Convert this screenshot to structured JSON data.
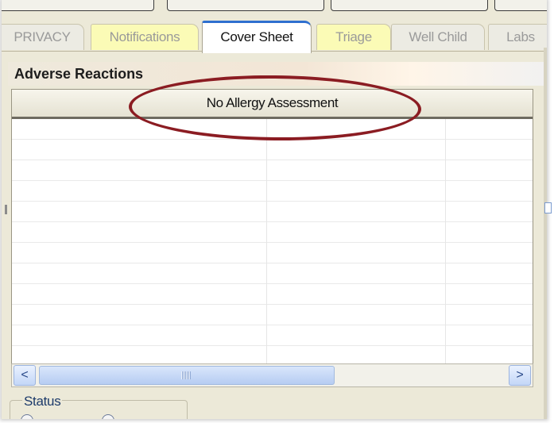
{
  "tabs": [
    {
      "label": "PRIVACY",
      "style": "grey"
    },
    {
      "label": "Notifications",
      "style": "yellow"
    },
    {
      "label": "Cover Sheet",
      "style": "active"
    },
    {
      "label": "Triage",
      "style": "yellow"
    },
    {
      "label": "Well Child",
      "style": "grey"
    },
    {
      "label": "Labs",
      "style": "grey"
    }
  ],
  "panel": {
    "title": "Adverse Reactions",
    "column_header": "No Allergy Assessment",
    "annotation_color": "#8b1c22"
  },
  "scrollbar": {
    "left_arrow": "<",
    "right_arrow": ">"
  },
  "status": {
    "label": "Status"
  },
  "colors": {
    "active_tab_accent": "#2e6fcf",
    "yellow_tab": "#fbfbb6",
    "window_bg": "#ece9d8"
  }
}
